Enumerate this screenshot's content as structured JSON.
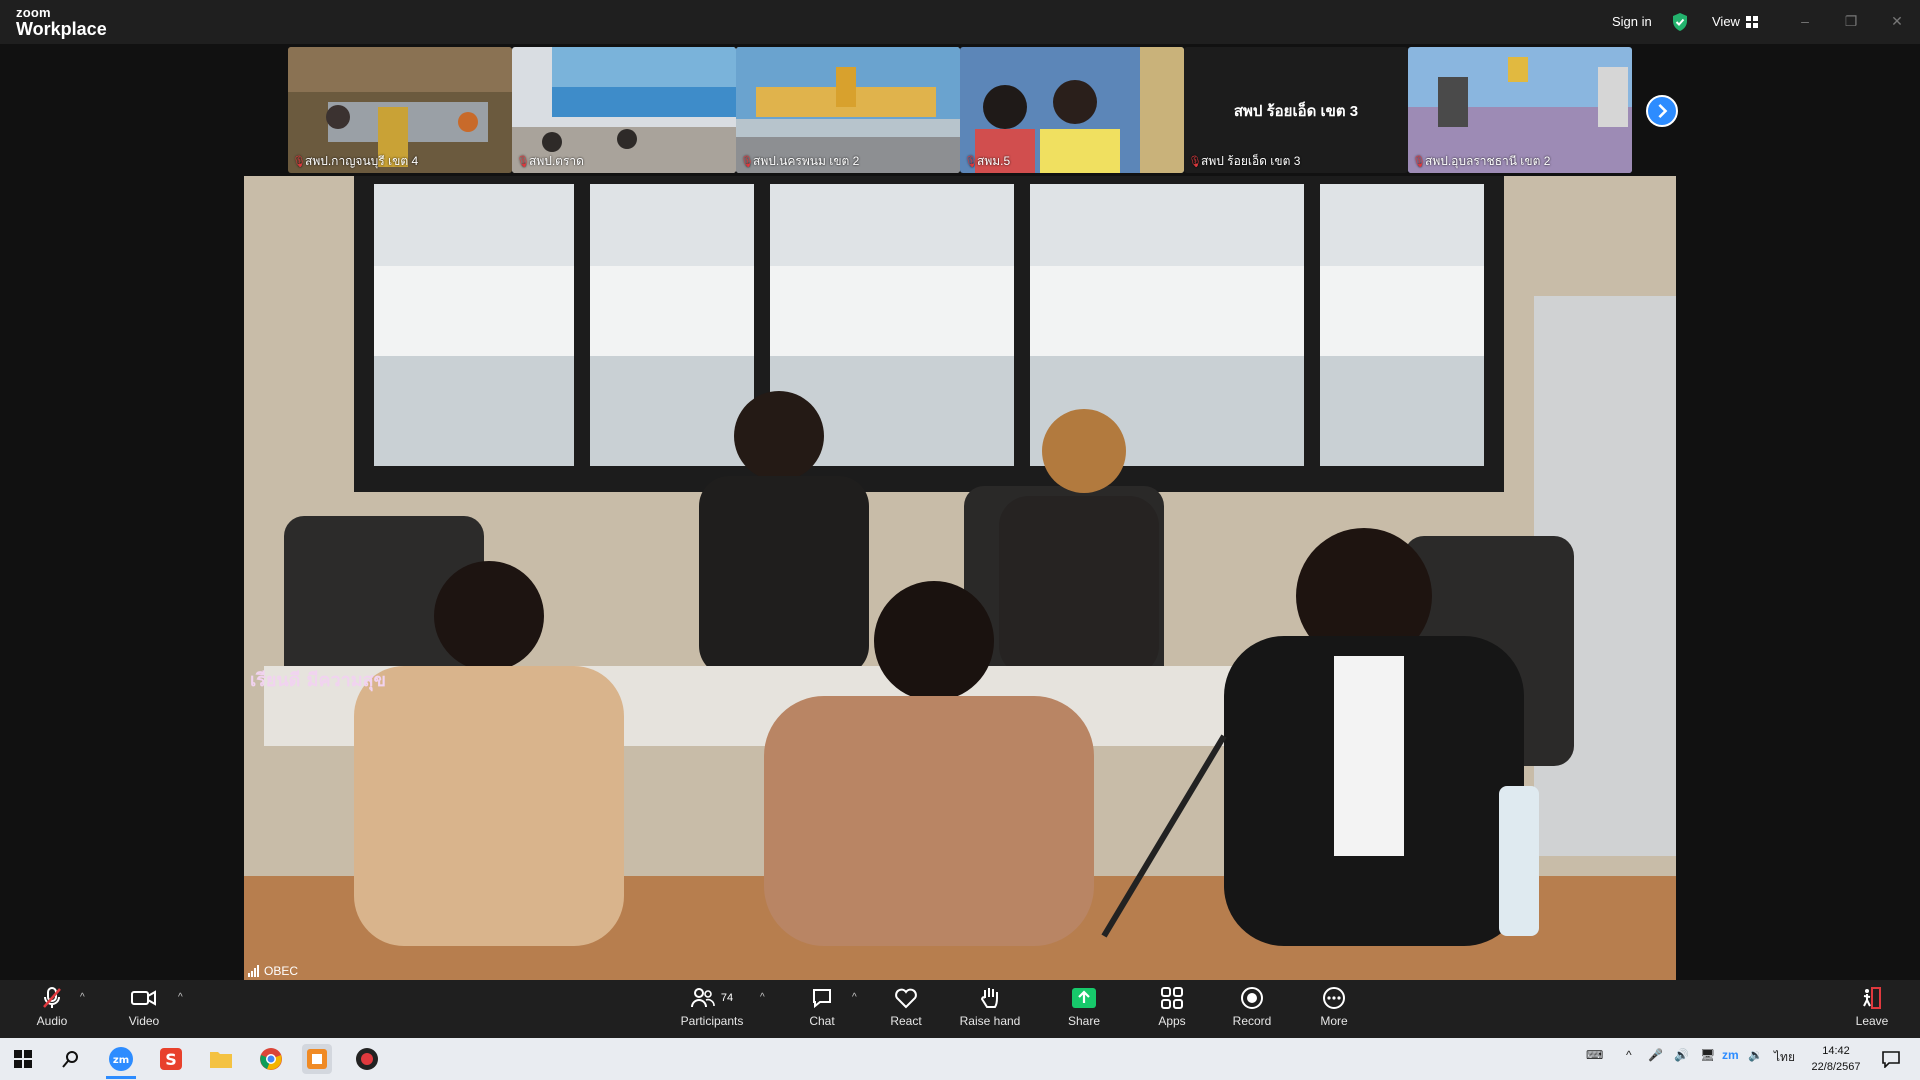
{
  "titlebar": {
    "brand_small": "zoom",
    "brand_large": "Workplace",
    "signin": "Sign in",
    "view": "View"
  },
  "thumbnails": [
    {
      "label": "สพป.กาญจนบุรี เขต 4",
      "bg": "#6b5a3e"
    },
    {
      "label": "สพป.ตราด",
      "bg": "#b9c9d8"
    },
    {
      "label": "สพป.นครพนม เขต 2",
      "bg": "#8fa9b8"
    },
    {
      "label": "สพม.5",
      "bg": "#6f8fb0"
    },
    {
      "label": "สพป ร้อยเอ็ด เขต 3",
      "big": "สพป ร้อยเอ็ด เขต 3",
      "bg": "#1c1c1c"
    },
    {
      "label": "สพป.อุบลราชธานี เขต 2",
      "bg": "#7ea7cf"
    }
  ],
  "main_video": {
    "label": "OBEC",
    "watermark": "เรียนดี มีความสุข"
  },
  "toolbar": {
    "audio": "Audio",
    "video": "Video",
    "participants": "Participants",
    "participants_count": "74",
    "chat": "Chat",
    "react": "React",
    "raise_hand": "Raise hand",
    "share": "Share",
    "apps": "Apps",
    "record": "Record",
    "more": "More",
    "leave": "Leave"
  },
  "taskbar": {
    "lang": "ไทย",
    "time": "14:42",
    "date": "22/8/2567"
  },
  "colors": {
    "accent": "#2d8cff",
    "share": "#17c96b",
    "muted": "#e0393e"
  }
}
